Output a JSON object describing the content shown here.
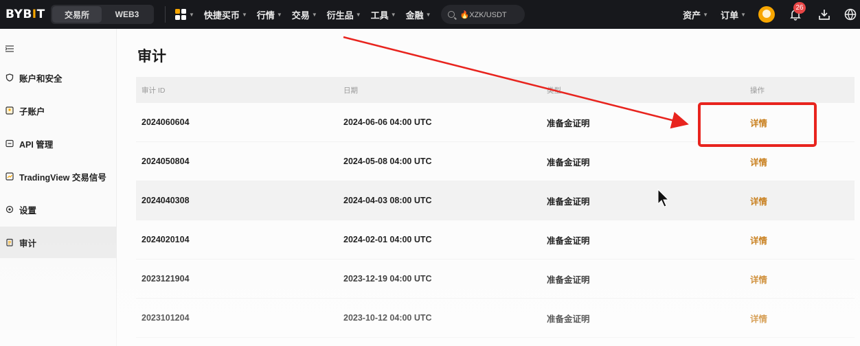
{
  "topbar": {
    "logo": "BYBIT",
    "segments": [
      "交易所",
      "WEB3"
    ],
    "nav_items": [
      "快捷买币",
      "行情",
      "交易",
      "衍生品",
      "工具",
      "金融"
    ],
    "search_text": "🔥XZK/USDT",
    "right_items": [
      "资产",
      "订单"
    ],
    "notification_count": "26"
  },
  "sidebar": {
    "items": [
      {
        "label": "账户和安全",
        "icon": "shield-icon"
      },
      {
        "label": "子账户",
        "icon": "sub-account-icon"
      },
      {
        "label": "API 管理",
        "icon": "api-icon"
      },
      {
        "label": "TradingView 交易信号",
        "icon": "tradingview-icon"
      },
      {
        "label": "设置",
        "icon": "gear-icon"
      },
      {
        "label": "审计",
        "icon": "audit-icon",
        "active": true
      }
    ]
  },
  "main": {
    "title": "审计",
    "table": {
      "headers": [
        "审计 ID",
        "日期",
        "类型",
        "操作"
      ],
      "rows": [
        {
          "id": "2024060604",
          "date": "2024-06-06 04:00 UTC",
          "type": "准备金证明",
          "action": "详情"
        },
        {
          "id": "2024050804",
          "date": "2024-05-08 04:00 UTC",
          "type": "准备金证明",
          "action": "详情"
        },
        {
          "id": "2024040308",
          "date": "2024-04-03 08:00 UTC",
          "type": "准备金证明",
          "action": "详情"
        },
        {
          "id": "2024020104",
          "date": "2024-02-01 04:00 UTC",
          "type": "准备金证明",
          "action": "详情"
        },
        {
          "id": "2023121904",
          "date": "2023-12-19 04:00 UTC",
          "type": "准备金证明",
          "action": "详情"
        },
        {
          "id": "2023101204",
          "date": "2023-10-12 04:00 UTC",
          "type": "准备金证明",
          "action": "详情"
        }
      ]
    }
  },
  "colors": {
    "accent": "#f7a600",
    "link": "#c9801f",
    "annotation": "#e8241e"
  }
}
